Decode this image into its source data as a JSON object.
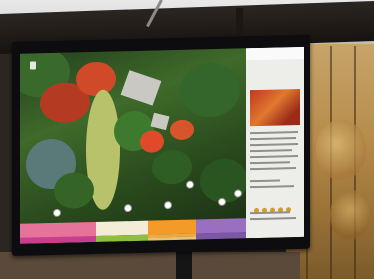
{
  "map": {
    "tag": "",
    "pins": 6
  },
  "side_panel": {
    "header": "",
    "title": ""
  },
  "buttons": {
    "b1": "",
    "b2": "",
    "b3": "",
    "b4": "",
    "b5": "",
    "b6": "",
    "b7": "",
    "b8": "",
    "b9": ""
  },
  "colors": {
    "pink": "#e6739a",
    "cream": "#f3ecd7",
    "orange": "#f39a28",
    "purple": "#9a6fc2",
    "magenta": "#c93d8f",
    "green": "#8fbf3d",
    "light_orange": "#f2a93a"
  }
}
